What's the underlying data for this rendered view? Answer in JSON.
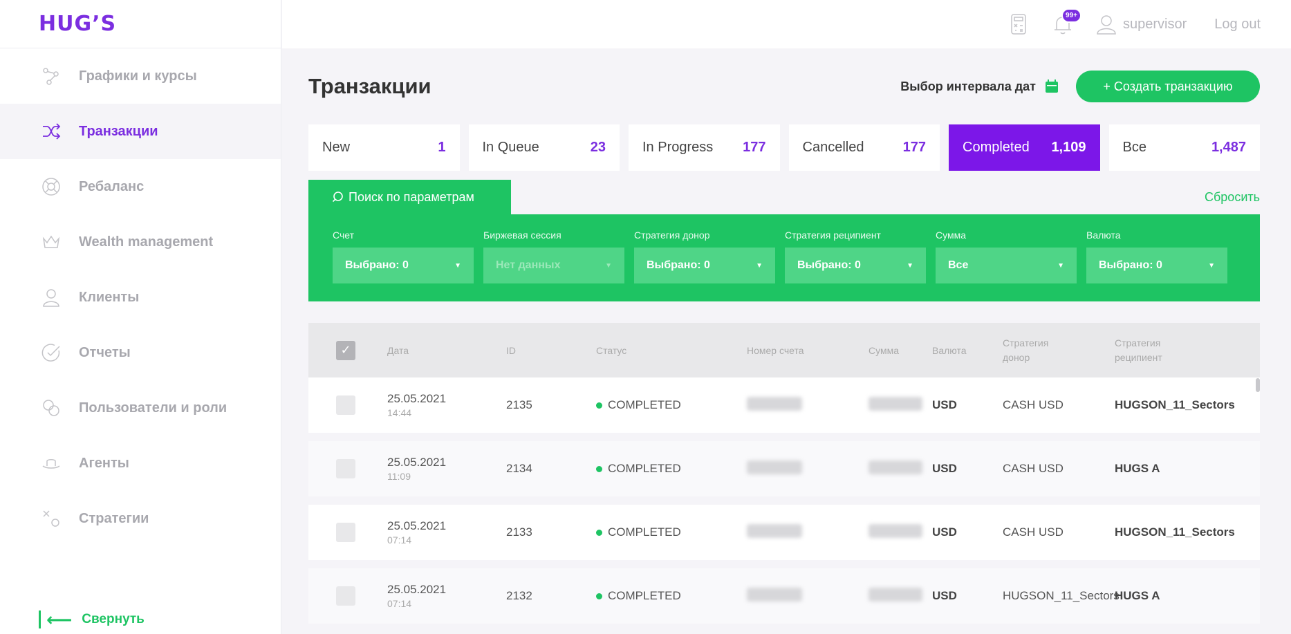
{
  "app": {
    "logo": "HUG’S"
  },
  "sidebar": {
    "items": [
      {
        "label": "Графики и курсы",
        "icon": "chart-nodes-icon"
      },
      {
        "label": "Транзакции",
        "icon": "shuffle-icon",
        "active": true
      },
      {
        "label": "Ребаланс",
        "icon": "lifebuoy-icon"
      },
      {
        "label": "Wealth management",
        "icon": "crown-icon"
      },
      {
        "label": "Клиенты",
        "icon": "person-icon"
      },
      {
        "label": "Отчеты",
        "icon": "check-circle-icon"
      },
      {
        "label": "Пользователи и роли",
        "icon": "users-icon"
      },
      {
        "label": "Агенты",
        "icon": "hat-icon"
      },
      {
        "label": "Стратегии",
        "icon": "strategy-icon"
      }
    ],
    "collapse_label": "Свернуть"
  },
  "header": {
    "notifications_badge": "99+",
    "username": "supervisor",
    "logout_label": "Log out"
  },
  "page": {
    "title": "Транзакции",
    "date_range_label": "Выбор интервала дат",
    "create_button": "+ Создать транзакцию"
  },
  "stats": [
    {
      "label": "New",
      "count": "1"
    },
    {
      "label": "In Queue",
      "count": "23"
    },
    {
      "label": "In Progress",
      "count": "177"
    },
    {
      "label": "Cancelled",
      "count": "177"
    },
    {
      "label": "Completed",
      "count": "1,109",
      "active": true
    },
    {
      "label": "Все",
      "count": "1,487"
    }
  ],
  "search": {
    "tab_label": "Поиск по параметрам",
    "reset_label": "Сбросить",
    "filters": [
      {
        "label": "Счет",
        "value": "Выбрано: 0"
      },
      {
        "label": "Биржевая сессия",
        "value": "Нет данных",
        "disabled": true
      },
      {
        "label": "Стратегия донор",
        "value": "Выбрано: 0"
      },
      {
        "label": "Стратегия реципиент",
        "value": "Выбрано: 0"
      },
      {
        "label": "Сумма",
        "value": "Все"
      },
      {
        "label": "Валюта",
        "value": "Выбрано: 0"
      }
    ]
  },
  "table": {
    "columns": {
      "date": "Дата",
      "id": "ID",
      "status": "Статус",
      "account": "Номер счета",
      "sum": "Сумма",
      "currency": "Валюта",
      "donor": "Стратегия донор",
      "recipient": "Стратегия реципиент"
    },
    "rows": [
      {
        "date": "25.05.2021",
        "time": "14:44",
        "id": "2135",
        "status": "COMPLETED",
        "currency": "USD",
        "donor": "CASH USD",
        "recipient": "HUGSON_11_Sectors"
      },
      {
        "date": "25.05.2021",
        "time": "11:09",
        "id": "2134",
        "status": "COMPLETED",
        "currency": "USD",
        "donor": "CASH USD",
        "recipient": "HUGS A"
      },
      {
        "date": "25.05.2021",
        "time": "07:14",
        "id": "2133",
        "status": "COMPLETED",
        "currency": "USD",
        "donor": "CASH USD",
        "recipient": "HUGSON_11_Sectors"
      },
      {
        "date": "25.05.2021",
        "time": "07:14",
        "id": "2132",
        "status": "COMPLETED",
        "currency": "USD",
        "donor": "HUGSON_11_Sectors",
        "recipient": "HUGS A"
      }
    ]
  },
  "colors": {
    "accent": "#7b2ee0",
    "green": "#1ec463"
  }
}
